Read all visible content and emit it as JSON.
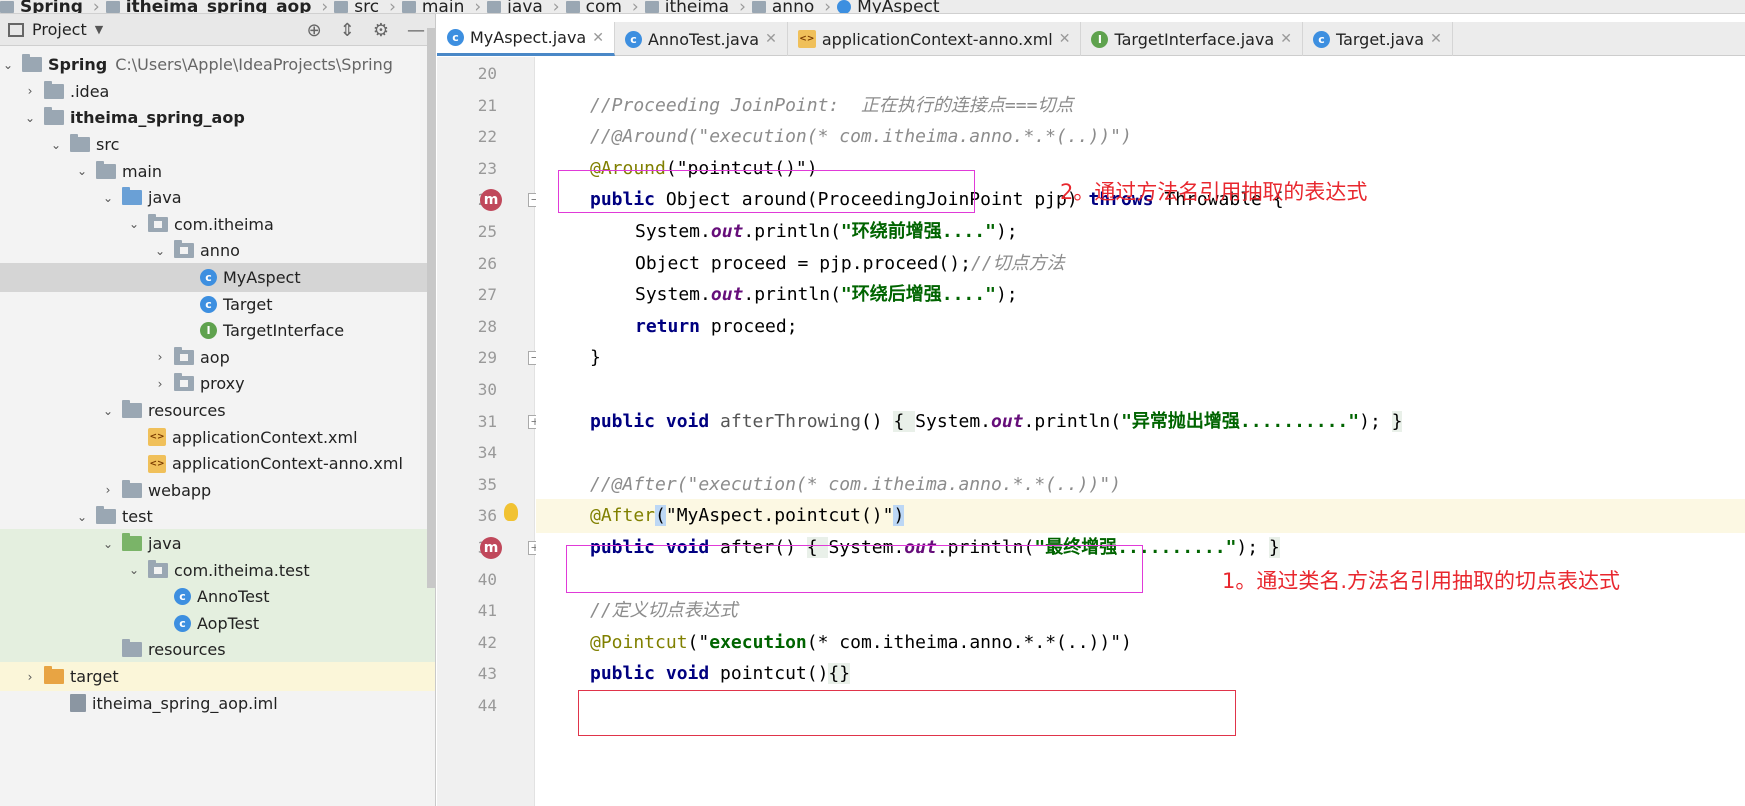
{
  "breadcrumbs": [
    "Spring",
    "itheima_spring_aop",
    "src",
    "main",
    "java",
    "com",
    "itheima",
    "anno",
    "MyAspect"
  ],
  "project_panel": {
    "title": "Project",
    "tree": [
      {
        "label": "Spring",
        "path": "C:\\Users\\Apple\\IdeaProjects\\Spring",
        "icon": "module-icon",
        "depth": 0,
        "expanded": true,
        "bold": true
      },
      {
        "label": ".idea",
        "icon": "folder-icon",
        "depth": 1,
        "expanded": false
      },
      {
        "label": "itheima_spring_aop",
        "icon": "module-icon",
        "depth": 1,
        "expanded": true,
        "bold": true
      },
      {
        "label": "src",
        "icon": "folder-icon",
        "depth": 2,
        "expanded": true
      },
      {
        "label": "main",
        "icon": "folder-icon",
        "depth": 3,
        "expanded": true
      },
      {
        "label": "java",
        "icon": "source-folder-icon",
        "depth": 4,
        "expanded": true
      },
      {
        "label": "com.itheima",
        "icon": "package-icon",
        "depth": 5,
        "expanded": true
      },
      {
        "label": "anno",
        "icon": "package-icon",
        "depth": 6,
        "expanded": true
      },
      {
        "label": "MyAspect",
        "icon": "class-icon",
        "depth": 7,
        "selected": true
      },
      {
        "label": "Target",
        "icon": "class-icon",
        "depth": 7
      },
      {
        "label": "TargetInterface",
        "icon": "interface-icon",
        "depth": 7
      },
      {
        "label": "aop",
        "icon": "package-icon",
        "depth": 6,
        "expanded": false
      },
      {
        "label": "proxy",
        "icon": "package-icon",
        "depth": 6,
        "expanded": false
      },
      {
        "label": "resources",
        "icon": "resources-folder-icon",
        "depth": 4,
        "expanded": true
      },
      {
        "label": "applicationContext.xml",
        "icon": "xml-icon",
        "depth": 5
      },
      {
        "label": "applicationContext-anno.xml",
        "icon": "xml-icon",
        "depth": 5
      },
      {
        "label": "webapp",
        "icon": "folder-icon",
        "depth": 4,
        "expanded": false
      },
      {
        "label": "test",
        "icon": "folder-icon",
        "depth": 3,
        "expanded": true
      },
      {
        "label": "java",
        "icon": "test-folder-icon",
        "depth": 4,
        "expanded": true,
        "green": true
      },
      {
        "label": "com.itheima.test",
        "icon": "package-icon",
        "depth": 5,
        "expanded": true,
        "green": true
      },
      {
        "label": "AnnoTest",
        "icon": "class-icon",
        "depth": 6,
        "green": true
      },
      {
        "label": "AopTest",
        "icon": "class-icon",
        "depth": 6,
        "green": true
      },
      {
        "label": "resources",
        "icon": "resources-folder-icon",
        "depth": 4,
        "green": true
      },
      {
        "label": "target",
        "icon": "excluded-folder-icon",
        "depth": 1,
        "expanded": false,
        "yellow": true
      },
      {
        "label": "itheima_spring_aop.iml",
        "icon": "iml-icon",
        "depth": 2
      }
    ]
  },
  "tabs": [
    {
      "label": "MyAspect.java",
      "icon": "class-icon",
      "active": true
    },
    {
      "label": "AnnoTest.java",
      "icon": "class-icon"
    },
    {
      "label": "applicationContext-anno.xml",
      "icon": "xml-icon"
    },
    {
      "label": "TargetInterface.java",
      "icon": "interface-icon"
    },
    {
      "label": "Target.java",
      "icon": "class-icon"
    }
  ],
  "code_lines": [
    {
      "num": "20",
      "tokens": []
    },
    {
      "num": "21",
      "tokens": [
        {
          "t": "cmt",
          "v": "//Proceeding JoinPoint:  正在执行的连接点===切点"
        }
      ]
    },
    {
      "num": "22",
      "tokens": [
        {
          "t": "cmt",
          "v": "//@Around(\"execution(* com.itheima.anno.*.*(..))\")"
        }
      ]
    },
    {
      "num": "23",
      "tokens": [
        {
          "t": "ann",
          "v": "@Around"
        },
        {
          "t": "",
          "v": "(\""
        },
        {
          "t": "",
          "v": "pointcut()"
        },
        {
          "t": "",
          "v": "\")"
        }
      ]
    },
    {
      "num": "24",
      "tokens": [
        {
          "t": "kw",
          "v": "public "
        },
        {
          "t": "",
          "v": "Object around(ProceedingJoinPoint pjp) "
        },
        {
          "t": "kw",
          "v": "throws "
        },
        {
          "t": "",
          "v": "Throwable {"
        }
      ]
    },
    {
      "num": "25",
      "indent": true,
      "tokens": [
        {
          "t": "",
          "v": "System."
        },
        {
          "t": "fld",
          "v": "out"
        },
        {
          "t": "",
          "v": ".println("
        },
        {
          "t": "str",
          "v": "\"环绕前增强....\""
        },
        {
          "t": "",
          "v": ");"
        }
      ]
    },
    {
      "num": "26",
      "indent": true,
      "tokens": [
        {
          "t": "",
          "v": "Object proceed = pjp.proceed();"
        },
        {
          "t": "cmt",
          "v": "//切点方法"
        }
      ]
    },
    {
      "num": "27",
      "indent": true,
      "tokens": [
        {
          "t": "",
          "v": "System."
        },
        {
          "t": "fld",
          "v": "out"
        },
        {
          "t": "",
          "v": ".println("
        },
        {
          "t": "str",
          "v": "\"环绕后增强....\""
        },
        {
          "t": "",
          "v": ");"
        }
      ]
    },
    {
      "num": "28",
      "indent": true,
      "tokens": [
        {
          "t": "kw",
          "v": "return "
        },
        {
          "t": "",
          "v": "proceed;"
        }
      ]
    },
    {
      "num": "29",
      "tokens": [
        {
          "t": "",
          "v": "}"
        }
      ]
    },
    {
      "num": "30",
      "tokens": []
    },
    {
      "num": "31",
      "tokens": [
        {
          "t": "kw",
          "v": "public void "
        },
        {
          "t": "mname",
          "v": "afterThrowing"
        },
        {
          "t": "",
          "v": "() "
        },
        {
          "t": "brace",
          "v": "{ "
        },
        {
          "t": "",
          "v": "System."
        },
        {
          "t": "fld",
          "v": "out"
        },
        {
          "t": "",
          "v": ".println("
        },
        {
          "t": "str",
          "v": "\"异常抛出增强..........\""
        },
        {
          "t": "",
          "v": "); "
        },
        {
          "t": "brace",
          "v": "}"
        }
      ]
    },
    {
      "num": "34",
      "tokens": []
    },
    {
      "num": "35",
      "tokens": [
        {
          "t": "cmt",
          "v": "//@After(\"execution(* com.itheima.anno.*.*(..))\")"
        }
      ]
    },
    {
      "num": "36",
      "highlight": true,
      "tokens": [
        {
          "t": "ann",
          "v": "@After"
        },
        {
          "t": "caretsel",
          "v": "("
        },
        {
          "t": "",
          "v": "\"MyAspect.pointcut()\""
        },
        {
          "t": "caretsel",
          "v": ")"
        }
      ]
    },
    {
      "num": "37",
      "tokens": [
        {
          "t": "kw",
          "v": "public void "
        },
        {
          "t": "",
          "v": "after() "
        },
        {
          "t": "brace",
          "v": "{ "
        },
        {
          "t": "",
          "v": "System."
        },
        {
          "t": "fld",
          "v": "out"
        },
        {
          "t": "",
          "v": ".println("
        },
        {
          "t": "str",
          "v": "\"最终增强..........\""
        },
        {
          "t": "",
          "v": "); "
        },
        {
          "t": "brace",
          "v": "}"
        }
      ]
    },
    {
      "num": "40",
      "tokens": []
    },
    {
      "num": "41",
      "tokens": [
        {
          "t": "cmt",
          "v": "//定义切点表达式"
        }
      ]
    },
    {
      "num": "42",
      "tokens": [
        {
          "t": "ann",
          "v": "@Pointcut"
        },
        {
          "t": "",
          "v": "(\""
        },
        {
          "t": "str",
          "v": "execution"
        },
        {
          "t": "",
          "v": "(* com.itheima.anno.*.*(..))\")"
        }
      ]
    },
    {
      "num": "43",
      "tokens": [
        {
          "t": "kw",
          "v": "public void "
        },
        {
          "t": "",
          "v": "pointcut()"
        },
        {
          "t": "brace",
          "v": "{}"
        }
      ]
    },
    {
      "num": "44",
      "tokens": []
    }
  ],
  "annotations": {
    "note_method_name": "2。通过方法名引用抽取的表达式",
    "note_class_method_name": "1。通过类名.方法名引用抽取的切点表达式"
  },
  "colors": {
    "annotation_box": "#e03ad8",
    "pointcut_box": "#e0344a",
    "note_text": "#e8272e"
  }
}
